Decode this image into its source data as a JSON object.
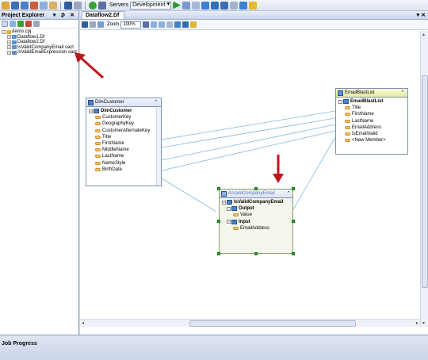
{
  "toolbar": {
    "servers_label": "Servers",
    "server_value": "Development"
  },
  "explorer": {
    "title": "Project Explorer",
    "controls": "▾ ⊅ ✕",
    "tree": {
      "root": "demo.cpj",
      "items": [
        "Dataflow1.Df",
        "Dataflow2.Df",
        "IsValidCompanyEmail.sact",
        "IsValidEmailExpression.sact"
      ]
    }
  },
  "document": {
    "tab_label": "Dataflow2.Df",
    "zoom_label": "Zoom",
    "zoom_value": "100%"
  },
  "dim_customer": {
    "title": "DimCustomer",
    "table": "DimCustomer",
    "columns": [
      "CustomerKey",
      "GeographyKey",
      "CustomerAlternateKey",
      "Title",
      "FirstName",
      "MiddleName",
      "LastName",
      "NameStyle",
      "BirthDate"
    ]
  },
  "email_blast": {
    "title": "EmailBlastList",
    "table": "EmailBlastList",
    "columns": [
      "Title",
      "FirstName",
      "LastName",
      "EmailAddress",
      "IsEmailValid",
      "<New Member>"
    ]
  },
  "validator": {
    "title": "IsValidCompanyEmail",
    "table": "IsValidCompanyEmail",
    "output_label": "Output",
    "output_value": "Value",
    "input_label": "Input",
    "input_value": "EmailAddress"
  },
  "job_progress": {
    "title": "Job Progress"
  },
  "colors": {
    "arrow": "#c0161b",
    "link_line": "#7fb7dc",
    "handle": "#39b339"
  }
}
